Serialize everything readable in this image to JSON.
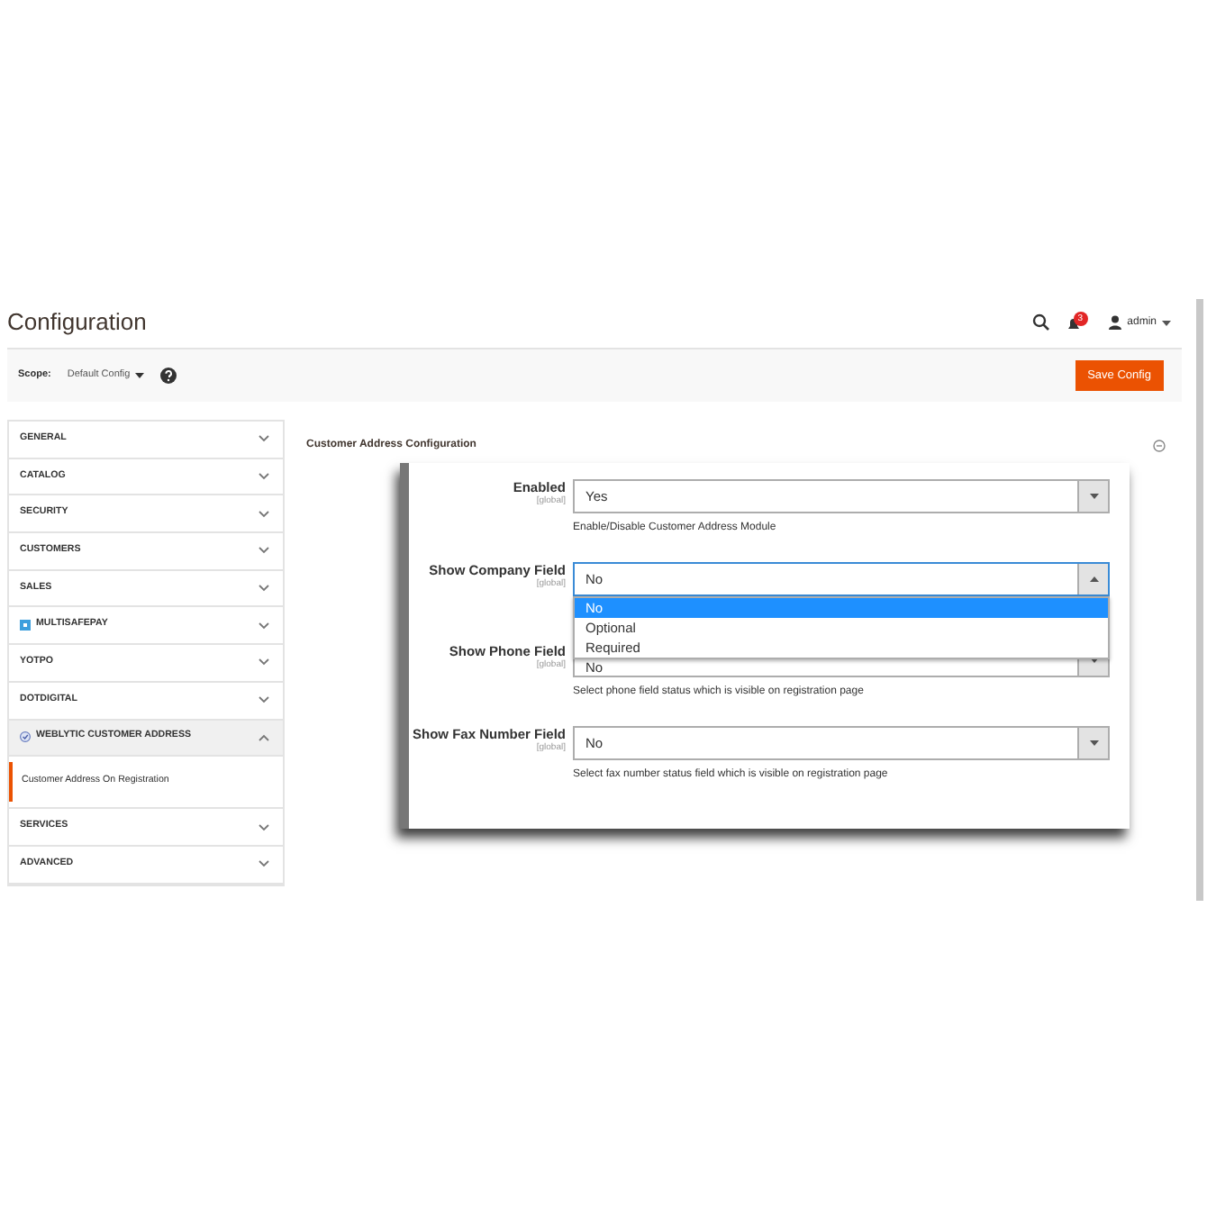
{
  "header": {
    "title": "Configuration",
    "notifications": "3",
    "user": "admin"
  },
  "scope": {
    "label": "Scope:",
    "value": "Default Config",
    "save": "Save Config"
  },
  "sidebar": {
    "items": [
      {
        "label": "GENERAL",
        "kind": "plain",
        "expanded": false
      },
      {
        "label": "CATALOG",
        "kind": "plain",
        "expanded": false
      },
      {
        "label": "SECURITY",
        "kind": "plain",
        "expanded": false
      },
      {
        "label": "CUSTOMERS",
        "kind": "plain",
        "expanded": false
      },
      {
        "label": "SALES",
        "kind": "plain",
        "expanded": false
      },
      {
        "label": "MULTISAFEPAY",
        "kind": "square-logo",
        "expanded": false
      },
      {
        "label": "YOTPO",
        "kind": "plain",
        "expanded": false
      },
      {
        "label": "DOTDIGITAL",
        "kind": "plain",
        "expanded": false
      },
      {
        "label": "WEBLYTIC CUSTOMER ADDRESS",
        "kind": "badge-logo",
        "expanded": true,
        "children": [
          {
            "label": "Customer Address On Registration",
            "selected": true
          }
        ]
      },
      {
        "label": "SERVICES",
        "kind": "plain",
        "expanded": false
      },
      {
        "label": "ADVANCED",
        "kind": "plain",
        "expanded": false
      }
    ]
  },
  "section": {
    "title": "Customer Address Configuration",
    "fields": [
      {
        "label": "Enabled",
        "scope": "[global]",
        "value": "Yes",
        "note": "Enable/Disable Customer Address Module",
        "open": false
      },
      {
        "label": "Show Company Field",
        "scope": "[global]",
        "value": "No",
        "open": true,
        "options": [
          {
            "label": "No",
            "selected": true
          },
          {
            "label": "Optional",
            "selected": false
          },
          {
            "label": "Required",
            "selected": false
          }
        ]
      },
      {
        "label": "Show Phone Field",
        "scope": "[global]",
        "value": "No",
        "note": "Select phone field status which is visible on registration page",
        "open": false
      },
      {
        "label": "Show Fax Number Field",
        "scope": "[global]",
        "value": "No",
        "note": "Select fax number status field which is visible on registration page",
        "open": false
      }
    ]
  }
}
